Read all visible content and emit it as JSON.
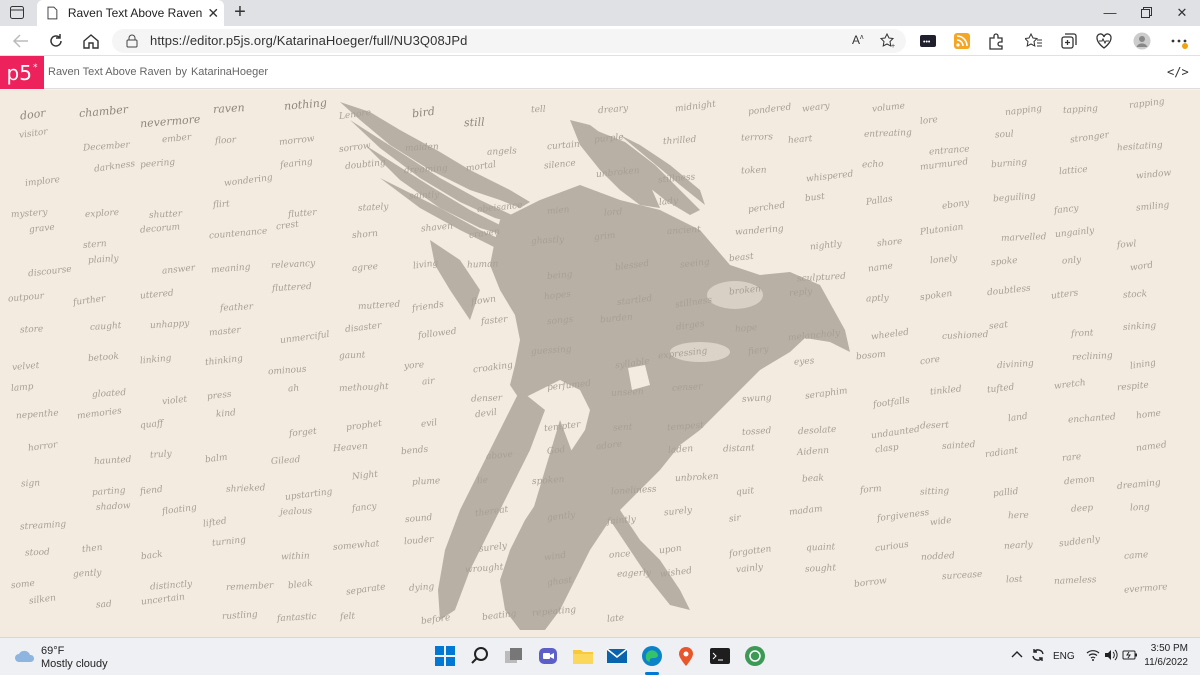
{
  "browser": {
    "tab_title": "Raven Text Above Raven",
    "tab_close": "✕",
    "new_tab": "+",
    "url": "https://editor.p5js.org/KatarinaHoeger/full/NU3Q08JPd"
  },
  "p5": {
    "logo": "p5",
    "logo_sup": "*",
    "sketch_name": "Raven Text Above Raven",
    "by": "by",
    "author": "KatarinaHoeger",
    "code_icon": "</>"
  },
  "canvas": {
    "background": "#f3ebdf",
    "raven_color": "#b8b0a5",
    "words": [
      {
        "t": "door",
        "big": true
      },
      {
        "t": "chamber",
        "big": true
      },
      {
        "t": "nevermore",
        "big": true
      },
      {
        "t": "raven",
        "big": true
      },
      {
        "t": "nothing",
        "big": true
      },
      {
        "t": "Lenore",
        "big": false
      },
      {
        "t": "bird",
        "big": true
      },
      {
        "t": "still",
        "big": true
      },
      {
        "t": "tell",
        "big": false
      },
      {
        "t": "dreary",
        "big": false
      },
      {
        "t": "midnight",
        "big": false
      },
      {
        "t": "pondered",
        "big": false
      },
      {
        "t": "weary",
        "big": false
      },
      {
        "t": "volume",
        "big": false
      },
      {
        "t": "lore",
        "big": false
      },
      {
        "t": "napping",
        "big": false
      },
      {
        "t": "tapping",
        "big": false
      },
      {
        "t": "rapping",
        "big": false
      },
      {
        "t": "visitor",
        "big": false
      },
      {
        "t": "December",
        "big": false
      },
      {
        "t": "ember",
        "big": false
      },
      {
        "t": "floor",
        "big": false
      },
      {
        "t": "morrow",
        "big": false
      },
      {
        "t": "sorrow",
        "big": false
      },
      {
        "t": "maiden",
        "big": false
      },
      {
        "t": "angels",
        "big": false
      },
      {
        "t": "curtain",
        "big": false
      },
      {
        "t": "purple",
        "big": false
      },
      {
        "t": "thrilled",
        "big": false
      },
      {
        "t": "terrors",
        "big": false
      },
      {
        "t": "heart",
        "big": false
      },
      {
        "t": "entreating",
        "big": false
      },
      {
        "t": "entrance",
        "big": false
      },
      {
        "t": "soul",
        "big": false
      },
      {
        "t": "stronger",
        "big": false
      },
      {
        "t": "hesitating",
        "big": false
      },
      {
        "t": "implore",
        "big": false
      },
      {
        "t": "darkness",
        "big": false
      },
      {
        "t": "peering",
        "big": false
      },
      {
        "t": "wondering",
        "big": false
      },
      {
        "t": "fearing",
        "big": false
      },
      {
        "t": "doubting",
        "big": false
      },
      {
        "t": "dreaming",
        "big": false
      },
      {
        "t": "mortal",
        "big": false
      },
      {
        "t": "silence",
        "big": false
      },
      {
        "t": "unbroken",
        "big": false
      },
      {
        "t": "stillness",
        "big": false
      },
      {
        "t": "token",
        "big": false
      },
      {
        "t": "whispered",
        "big": false
      },
      {
        "t": "echo",
        "big": false
      },
      {
        "t": "murmured",
        "big": false
      },
      {
        "t": "burning",
        "big": false
      },
      {
        "t": "lattice",
        "big": false
      },
      {
        "t": "window",
        "big": false
      },
      {
        "t": "mystery",
        "big": false
      },
      {
        "t": "explore",
        "big": false
      },
      {
        "t": "shutter",
        "big": false
      },
      {
        "t": "flirt",
        "big": false
      },
      {
        "t": "flutter",
        "big": false
      },
      {
        "t": "stately",
        "big": false
      },
      {
        "t": "saintly",
        "big": false
      },
      {
        "t": "obeisance",
        "big": false
      },
      {
        "t": "mien",
        "big": false
      },
      {
        "t": "lord",
        "big": false
      },
      {
        "t": "lady",
        "big": false
      },
      {
        "t": "perched",
        "big": false
      },
      {
        "t": "bust",
        "big": false
      },
      {
        "t": "Pallas",
        "big": false
      },
      {
        "t": "ebony",
        "big": false
      },
      {
        "t": "beguiling",
        "big": false
      },
      {
        "t": "fancy",
        "big": false
      },
      {
        "t": "smiling",
        "big": false
      },
      {
        "t": "grave",
        "big": false
      },
      {
        "t": "stern",
        "big": false
      },
      {
        "t": "decorum",
        "big": false
      },
      {
        "t": "countenance",
        "big": false
      },
      {
        "t": "crest",
        "big": false
      },
      {
        "t": "shorn",
        "big": false
      },
      {
        "t": "shaven",
        "big": false
      },
      {
        "t": "craven",
        "big": false
      },
      {
        "t": "ghastly",
        "big": false
      },
      {
        "t": "grim",
        "big": false
      },
      {
        "t": "ancient",
        "big": false
      },
      {
        "t": "wandering",
        "big": false
      },
      {
        "t": "nightly",
        "big": false
      },
      {
        "t": "shore",
        "big": false
      },
      {
        "t": "Plutonian",
        "big": false
      },
      {
        "t": "marvelled",
        "big": false
      },
      {
        "t": "ungainly",
        "big": false
      },
      {
        "t": "fowl",
        "big": false
      },
      {
        "t": "discourse",
        "big": false
      },
      {
        "t": "plainly",
        "big": false
      },
      {
        "t": "answer",
        "big": false
      },
      {
        "t": "meaning",
        "big": false
      },
      {
        "t": "relevancy",
        "big": false
      },
      {
        "t": "agree",
        "big": false
      },
      {
        "t": "living",
        "big": false
      },
      {
        "t": "human",
        "big": false
      },
      {
        "t": "being",
        "big": false
      },
      {
        "t": "blessed",
        "big": false
      },
      {
        "t": "seeing",
        "big": false
      },
      {
        "t": "beast",
        "big": false
      },
      {
        "t": "sculptured",
        "big": false
      },
      {
        "t": "name",
        "big": false
      },
      {
        "t": "lonely",
        "big": false
      },
      {
        "t": "spoke",
        "big": false
      },
      {
        "t": "only",
        "big": false
      },
      {
        "t": "word",
        "big": false
      },
      {
        "t": "outpour",
        "big": false
      },
      {
        "t": "further",
        "big": false
      },
      {
        "t": "uttered",
        "big": false
      },
      {
        "t": "feather",
        "big": false
      },
      {
        "t": "fluttered",
        "big": false
      },
      {
        "t": "muttered",
        "big": false
      },
      {
        "t": "friends",
        "big": false
      },
      {
        "t": "flown",
        "big": false
      },
      {
        "t": "hopes",
        "big": false
      },
      {
        "t": "startled",
        "big": false
      },
      {
        "t": "stillness",
        "big": false
      },
      {
        "t": "broken",
        "big": false
      },
      {
        "t": "reply",
        "big": false
      },
      {
        "t": "aptly",
        "big": false
      },
      {
        "t": "spoken",
        "big": false
      },
      {
        "t": "doubtless",
        "big": false
      },
      {
        "t": "utters",
        "big": false
      },
      {
        "t": "stock",
        "big": false
      },
      {
        "t": "store",
        "big": false
      },
      {
        "t": "caught",
        "big": false
      },
      {
        "t": "unhappy",
        "big": false
      },
      {
        "t": "master",
        "big": false
      },
      {
        "t": "unmerciful",
        "big": false
      },
      {
        "t": "disaster",
        "big": false
      },
      {
        "t": "followed",
        "big": false
      },
      {
        "t": "faster",
        "big": false
      },
      {
        "t": "songs",
        "big": false
      },
      {
        "t": "burden",
        "big": false
      },
      {
        "t": "dirges",
        "big": false
      },
      {
        "t": "hope",
        "big": false
      },
      {
        "t": "melancholy",
        "big": false
      },
      {
        "t": "wheeled",
        "big": false
      },
      {
        "t": "cushioned",
        "big": false
      },
      {
        "t": "seat",
        "big": false
      },
      {
        "t": "front",
        "big": false
      },
      {
        "t": "sinking",
        "big": false
      },
      {
        "t": "velvet",
        "big": false
      },
      {
        "t": "betook",
        "big": false
      },
      {
        "t": "linking",
        "big": false
      },
      {
        "t": "thinking",
        "big": false
      },
      {
        "t": "ominous",
        "big": false
      },
      {
        "t": "gaunt",
        "big": false
      },
      {
        "t": "yore",
        "big": false
      },
      {
        "t": "croaking",
        "big": false
      },
      {
        "t": "guessing",
        "big": false
      },
      {
        "t": "syllable",
        "big": false
      },
      {
        "t": "expressing",
        "big": false
      },
      {
        "t": "fiery",
        "big": false
      },
      {
        "t": "eyes",
        "big": false
      },
      {
        "t": "bosom",
        "big": false
      },
      {
        "t": "core",
        "big": false
      },
      {
        "t": "divining",
        "big": false
      },
      {
        "t": "reclining",
        "big": false
      },
      {
        "t": "lining",
        "big": false
      },
      {
        "t": "lamp",
        "big": false
      },
      {
        "t": "gloated",
        "big": false
      },
      {
        "t": "violet",
        "big": false
      },
      {
        "t": "press",
        "big": false
      },
      {
        "t": "ah",
        "big": false
      },
      {
        "t": "methought",
        "big": false
      },
      {
        "t": "air",
        "big": false
      },
      {
        "t": "denser",
        "big": false
      },
      {
        "t": "perfumed",
        "big": false
      },
      {
        "t": "unseen",
        "big": false
      },
      {
        "t": "censer",
        "big": false
      },
      {
        "t": "swung",
        "big": false
      },
      {
        "t": "seraphim",
        "big": false
      },
      {
        "t": "footfalls",
        "big": false
      },
      {
        "t": "tinkled",
        "big": false
      },
      {
        "t": "tufted",
        "big": false
      },
      {
        "t": "wretch",
        "big": false
      },
      {
        "t": "respite",
        "big": false
      },
      {
        "t": "nepenthe",
        "big": false
      },
      {
        "t": "memories",
        "big": false
      },
      {
        "t": "quaff",
        "big": false
      },
      {
        "t": "kind",
        "big": false
      },
      {
        "t": "forget",
        "big": false
      },
      {
        "t": "prophet",
        "big": false
      },
      {
        "t": "evil",
        "big": false
      },
      {
        "t": "devil",
        "big": false
      },
      {
        "t": "tempter",
        "big": false
      },
      {
        "t": "sent",
        "big": false
      },
      {
        "t": "tempest",
        "big": false
      },
      {
        "t": "tossed",
        "big": false
      },
      {
        "t": "desolate",
        "big": false
      },
      {
        "t": "undaunted",
        "big": false
      },
      {
        "t": "desert",
        "big": false
      },
      {
        "t": "land",
        "big": false
      },
      {
        "t": "enchanted",
        "big": false
      },
      {
        "t": "home",
        "big": false
      },
      {
        "t": "horror",
        "big": false
      },
      {
        "t": "haunted",
        "big": false
      },
      {
        "t": "truly",
        "big": false
      },
      {
        "t": "balm",
        "big": false
      },
      {
        "t": "Gilead",
        "big": false
      },
      {
        "t": "Heaven",
        "big": false
      },
      {
        "t": "bends",
        "big": false
      },
      {
        "t": "above",
        "big": false
      },
      {
        "t": "God",
        "big": false
      },
      {
        "t": "adore",
        "big": false
      },
      {
        "t": "laden",
        "big": false
      },
      {
        "t": "distant",
        "big": false
      },
      {
        "t": "Aidenn",
        "big": false
      },
      {
        "t": "clasp",
        "big": false
      },
      {
        "t": "sainted",
        "big": false
      },
      {
        "t": "radiant",
        "big": false
      },
      {
        "t": "rare",
        "big": false
      },
      {
        "t": "named",
        "big": false
      },
      {
        "t": "sign",
        "big": false
      },
      {
        "t": "parting",
        "big": false
      },
      {
        "t": "fiend",
        "big": false
      },
      {
        "t": "shrieked",
        "big": false
      },
      {
        "t": "upstarting",
        "big": false
      },
      {
        "t": "Night",
        "big": false
      },
      {
        "t": "plume",
        "big": false
      },
      {
        "t": "lie",
        "big": false
      },
      {
        "t": "spoken",
        "big": false
      },
      {
        "t": "loneliness",
        "big": false
      },
      {
        "t": "unbroken",
        "big": false
      },
      {
        "t": "quit",
        "big": false
      },
      {
        "t": "beak",
        "big": false
      },
      {
        "t": "form",
        "big": false
      },
      {
        "t": "sitting",
        "big": false
      },
      {
        "t": "pallid",
        "big": false
      },
      {
        "t": "demon",
        "big": false
      },
      {
        "t": "dreaming",
        "big": false
      },
      {
        "t": "streaming",
        "big": false
      },
      {
        "t": "shadow",
        "big": false
      },
      {
        "t": "floating",
        "big": false
      },
      {
        "t": "lifted",
        "big": false
      },
      {
        "t": "jealous",
        "big": false
      },
      {
        "t": "fancy",
        "big": false
      },
      {
        "t": "sound",
        "big": false
      },
      {
        "t": "thereat",
        "big": false
      },
      {
        "t": "gently",
        "big": false
      },
      {
        "t": "faintly",
        "big": false
      },
      {
        "t": "surely",
        "big": false
      },
      {
        "t": "sir",
        "big": false
      },
      {
        "t": "madam",
        "big": false
      },
      {
        "t": "forgiveness",
        "big": false
      },
      {
        "t": "wide",
        "big": false
      },
      {
        "t": "here",
        "big": false
      },
      {
        "t": "deep",
        "big": false
      },
      {
        "t": "long",
        "big": false
      },
      {
        "t": "stood",
        "big": false
      },
      {
        "t": "then",
        "big": false
      },
      {
        "t": "back",
        "big": false
      },
      {
        "t": "turning",
        "big": false
      },
      {
        "t": "within",
        "big": false
      },
      {
        "t": "somewhat",
        "big": false
      },
      {
        "t": "louder",
        "big": false
      },
      {
        "t": "surely",
        "big": false
      },
      {
        "t": "wind",
        "big": false
      },
      {
        "t": "once",
        "big": false
      },
      {
        "t": "upon",
        "big": false
      },
      {
        "t": "forgotten",
        "big": false
      },
      {
        "t": "quaint",
        "big": false
      },
      {
        "t": "curious",
        "big": false
      },
      {
        "t": "nodded",
        "big": false
      },
      {
        "t": "nearly",
        "big": false
      },
      {
        "t": "suddenly",
        "big": false
      },
      {
        "t": "came",
        "big": false
      },
      {
        "t": "some",
        "big": false
      },
      {
        "t": "gently",
        "big": false
      },
      {
        "t": "distinctly",
        "big": false
      },
      {
        "t": "remember",
        "big": false
      },
      {
        "t": "bleak",
        "big": false
      },
      {
        "t": "separate",
        "big": false
      },
      {
        "t": "dying",
        "big": false
      },
      {
        "t": "wrought",
        "big": false
      },
      {
        "t": "ghost",
        "big": false
      },
      {
        "t": "eagerly",
        "big": false
      },
      {
        "t": "wished",
        "big": false
      },
      {
        "t": "vainly",
        "big": false
      },
      {
        "t": "sought",
        "big": false
      },
      {
        "t": "borrow",
        "big": false
      },
      {
        "t": "surcease",
        "big": false
      },
      {
        "t": "lost",
        "big": false
      },
      {
        "t": "nameless",
        "big": false
      },
      {
        "t": "evermore",
        "big": false
      },
      {
        "t": "silken",
        "big": false
      },
      {
        "t": "sad",
        "big": false
      },
      {
        "t": "uncertain",
        "big": false
      },
      {
        "t": "rustling",
        "big": false
      },
      {
        "t": "fantastic",
        "big": false
      },
      {
        "t": "felt",
        "big": false
      },
      {
        "t": "before",
        "big": false
      },
      {
        "t": "beating",
        "big": false
      },
      {
        "t": "repeating",
        "big": false
      },
      {
        "t": "late",
        "big": false
      }
    ]
  },
  "taskbar": {
    "temp": "69°F",
    "weather": "Mostly cloudy",
    "lang": "ENG",
    "time": "3:50 PM",
    "date": "11/6/2022"
  }
}
